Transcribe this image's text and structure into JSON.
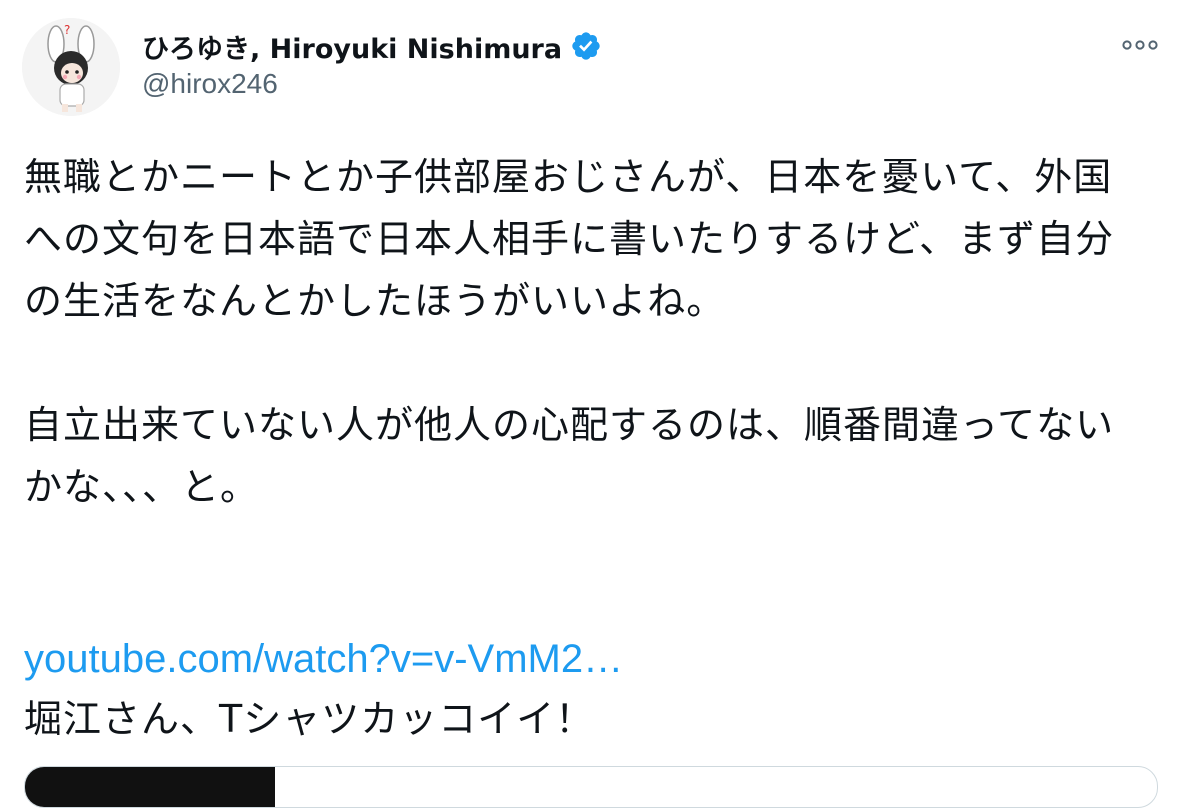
{
  "tweet": {
    "author": {
      "display_name": "ひろゆき, Hiroyuki Nishimura",
      "handle": "@hirox246",
      "verified_icon": "verified-badge-icon"
    },
    "more_icon": "more-options-icon",
    "paragraphs": [
      "無職とかニートとか子供部屋おじさんが、日本を憂いて、外国への文句を日本語で日本人相手に書いたりするけど、まず自分の生活をなんとかしたほうがいいよね。",
      "自立出来ていない人が他人の心配するのは、順番間違ってないかな、、、と。"
    ],
    "link_text": "youtube.com/watch?v=v-VmM2…",
    "after_link_text": "堀江さん、Tシャツカッコイイ！"
  },
  "colors": {
    "link": "#1d9bf0",
    "verified": "#1d9bf0",
    "handle": "#536471",
    "text": "#0f1419"
  }
}
